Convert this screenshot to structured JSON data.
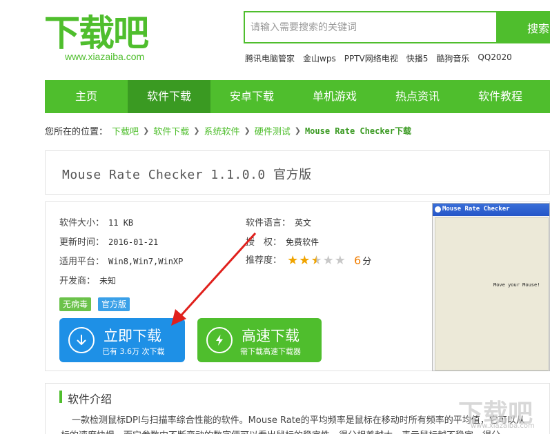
{
  "logo": {
    "text": "下载吧",
    "url": "www.xiazaiba.com"
  },
  "search": {
    "placeholder": "请输入需要搜索的关键词",
    "button_label": "搜索"
  },
  "hot_links": [
    "腾讯电脑管家",
    "金山wps",
    "PPTV网络电视",
    "快播5",
    "酷狗音乐",
    "QQ2020"
  ],
  "nav": {
    "items": [
      {
        "label": "主页"
      },
      {
        "label": "软件下载"
      },
      {
        "label": "安卓下载"
      },
      {
        "label": "单机游戏"
      },
      {
        "label": "热点资讯"
      },
      {
        "label": "软件教程"
      }
    ],
    "active_index": 1
  },
  "breadcrumb": {
    "prefix": "您所在的位置：",
    "items": [
      "下载吧",
      "软件下载",
      "系统软件",
      "硬件测试"
    ],
    "current": "Mouse Rate Checker下载"
  },
  "software": {
    "title": "Mouse Rate Checker 1.1.0.0 官方版",
    "size_label": "软件大小：",
    "size": "11 KB",
    "updated_label": "更新时间：",
    "updated": "2016-01-21",
    "platform_label": "适用平台：",
    "platform": "Win8,Win7,WinXP",
    "developer_label": "开发商：",
    "developer": "未知",
    "language_label": "软件语言：",
    "language": "英文",
    "license_label": "授　权：",
    "license": "免费软件",
    "rating_label": "推荐度：",
    "rating_stars": 2.5,
    "rating_max": 5,
    "score": "6",
    "score_unit": "分"
  },
  "tags": {
    "virus_free": "无病毒",
    "official": "官方版"
  },
  "download": {
    "main_title": "立即下载",
    "main_sub": "已有 3.6万 次下载",
    "fast_title": "高速下载",
    "fast_sub": "需下载高速下载器"
  },
  "preview": {
    "window_title": "Mouse Rate Checker",
    "body_text": "Move your Mouse!"
  },
  "intro": {
    "title": "软件介绍",
    "line1": "一款检测鼠标DPI与扫描率综合性能的软件。Mouse Rate的平均频率是鼠标在移动时所有频率的平均值，它可以从",
    "line2": "标的速度快慢，而它参数中不断变动的数字便可以看出鼠标的稳定性，得分相差越大，表示鼠标越不稳定，得分"
  },
  "watermark": {
    "text": "下载吧",
    "url": "www.xiazaiba.com"
  },
  "colors": {
    "brand_green": "#4fbe2d",
    "nav_active": "#3a9a22",
    "download_blue": "#1e90e6",
    "star": "#f0a400",
    "score": "#f07d00"
  }
}
